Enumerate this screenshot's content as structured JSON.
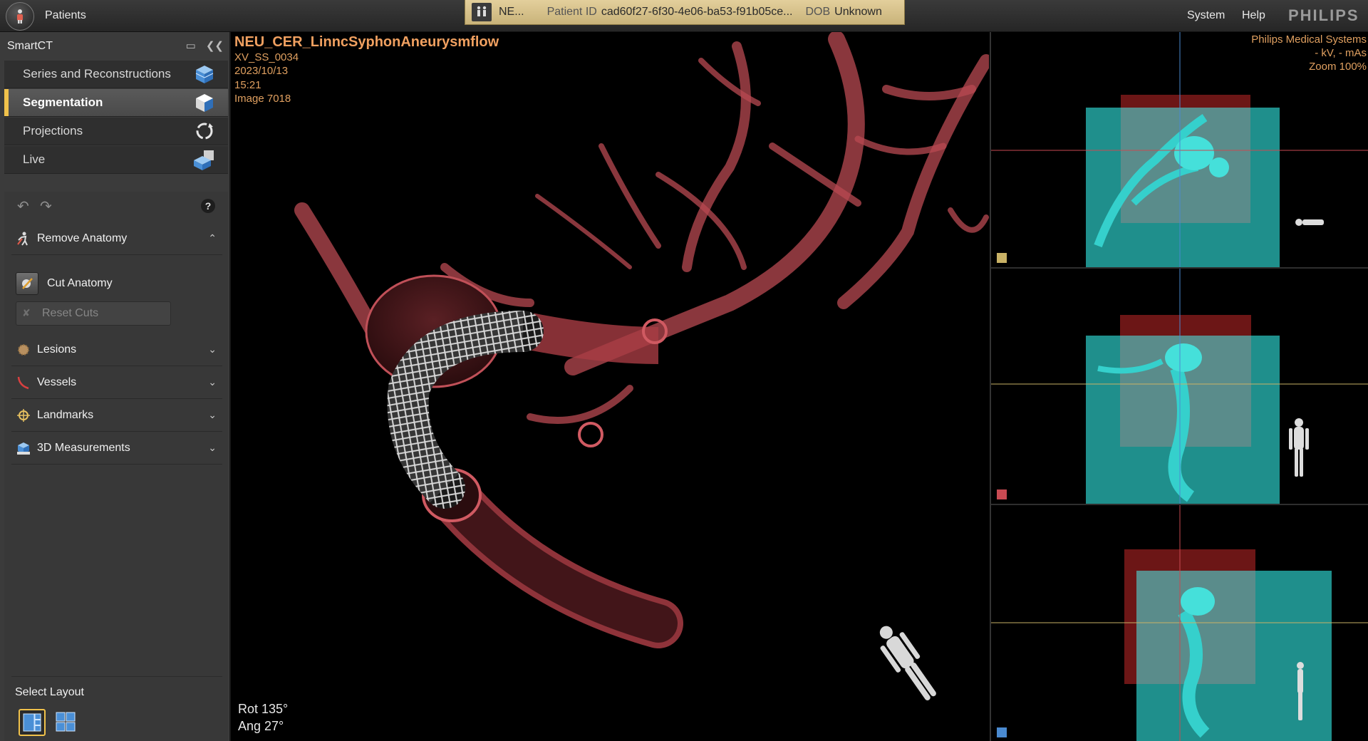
{
  "topbar": {
    "patients_label": "Patients",
    "patient_name": "NE...",
    "patient_id_label": "Patient ID",
    "patient_id_value": "cad60f27-6f30-4e06-ba53-f91b05ce...",
    "dob_label": "DOB",
    "dob_value": "Unknown",
    "system_label": "System",
    "help_label": "Help",
    "brand": "PHILIPS"
  },
  "sidebar": {
    "title": "SmartCT",
    "nav": [
      {
        "label": "Series and Reconstructions",
        "icon": "series-cube-icon"
      },
      {
        "label": "Segmentation",
        "icon": "segmentation-cube-icon",
        "active": true
      },
      {
        "label": "Projections",
        "icon": "projections-rotate-icon"
      },
      {
        "label": "Live",
        "icon": "live-cube-icon"
      }
    ],
    "remove_anatomy": "Remove Anatomy",
    "cut_anatomy": "Cut Anatomy",
    "reset_cuts": "Reset Cuts",
    "sections": [
      {
        "label": "Lesions",
        "icon": "lesions-icon"
      },
      {
        "label": "Vessels",
        "icon": "vessels-icon"
      },
      {
        "label": "Landmarks",
        "icon": "landmarks-icon"
      },
      {
        "label": "3D Measurements",
        "icon": "measurements-icon"
      }
    ],
    "select_layout": "Select Layout"
  },
  "main_view": {
    "title": "NEU_CER_LinncSyphonAneurysmflow",
    "series": "XV_SS_0034",
    "date": "2023/10/13",
    "time": "15:21",
    "image": "Image 7018",
    "rot": "Rot 135°",
    "ang": "Ang 27°"
  },
  "right_view": {
    "vendor": "Philips Medical Systems",
    "kv": "- kV, - mAs",
    "zoom": "Zoom 100%",
    "marker_colors": [
      "#c9b266",
      "#c84a52",
      "#4a8ad0"
    ]
  },
  "colors": {
    "accent": "#f1c24b",
    "overlay_text": "#e0a060",
    "vessel": "#c8565c",
    "slice_cyan": "#35d0cc"
  }
}
